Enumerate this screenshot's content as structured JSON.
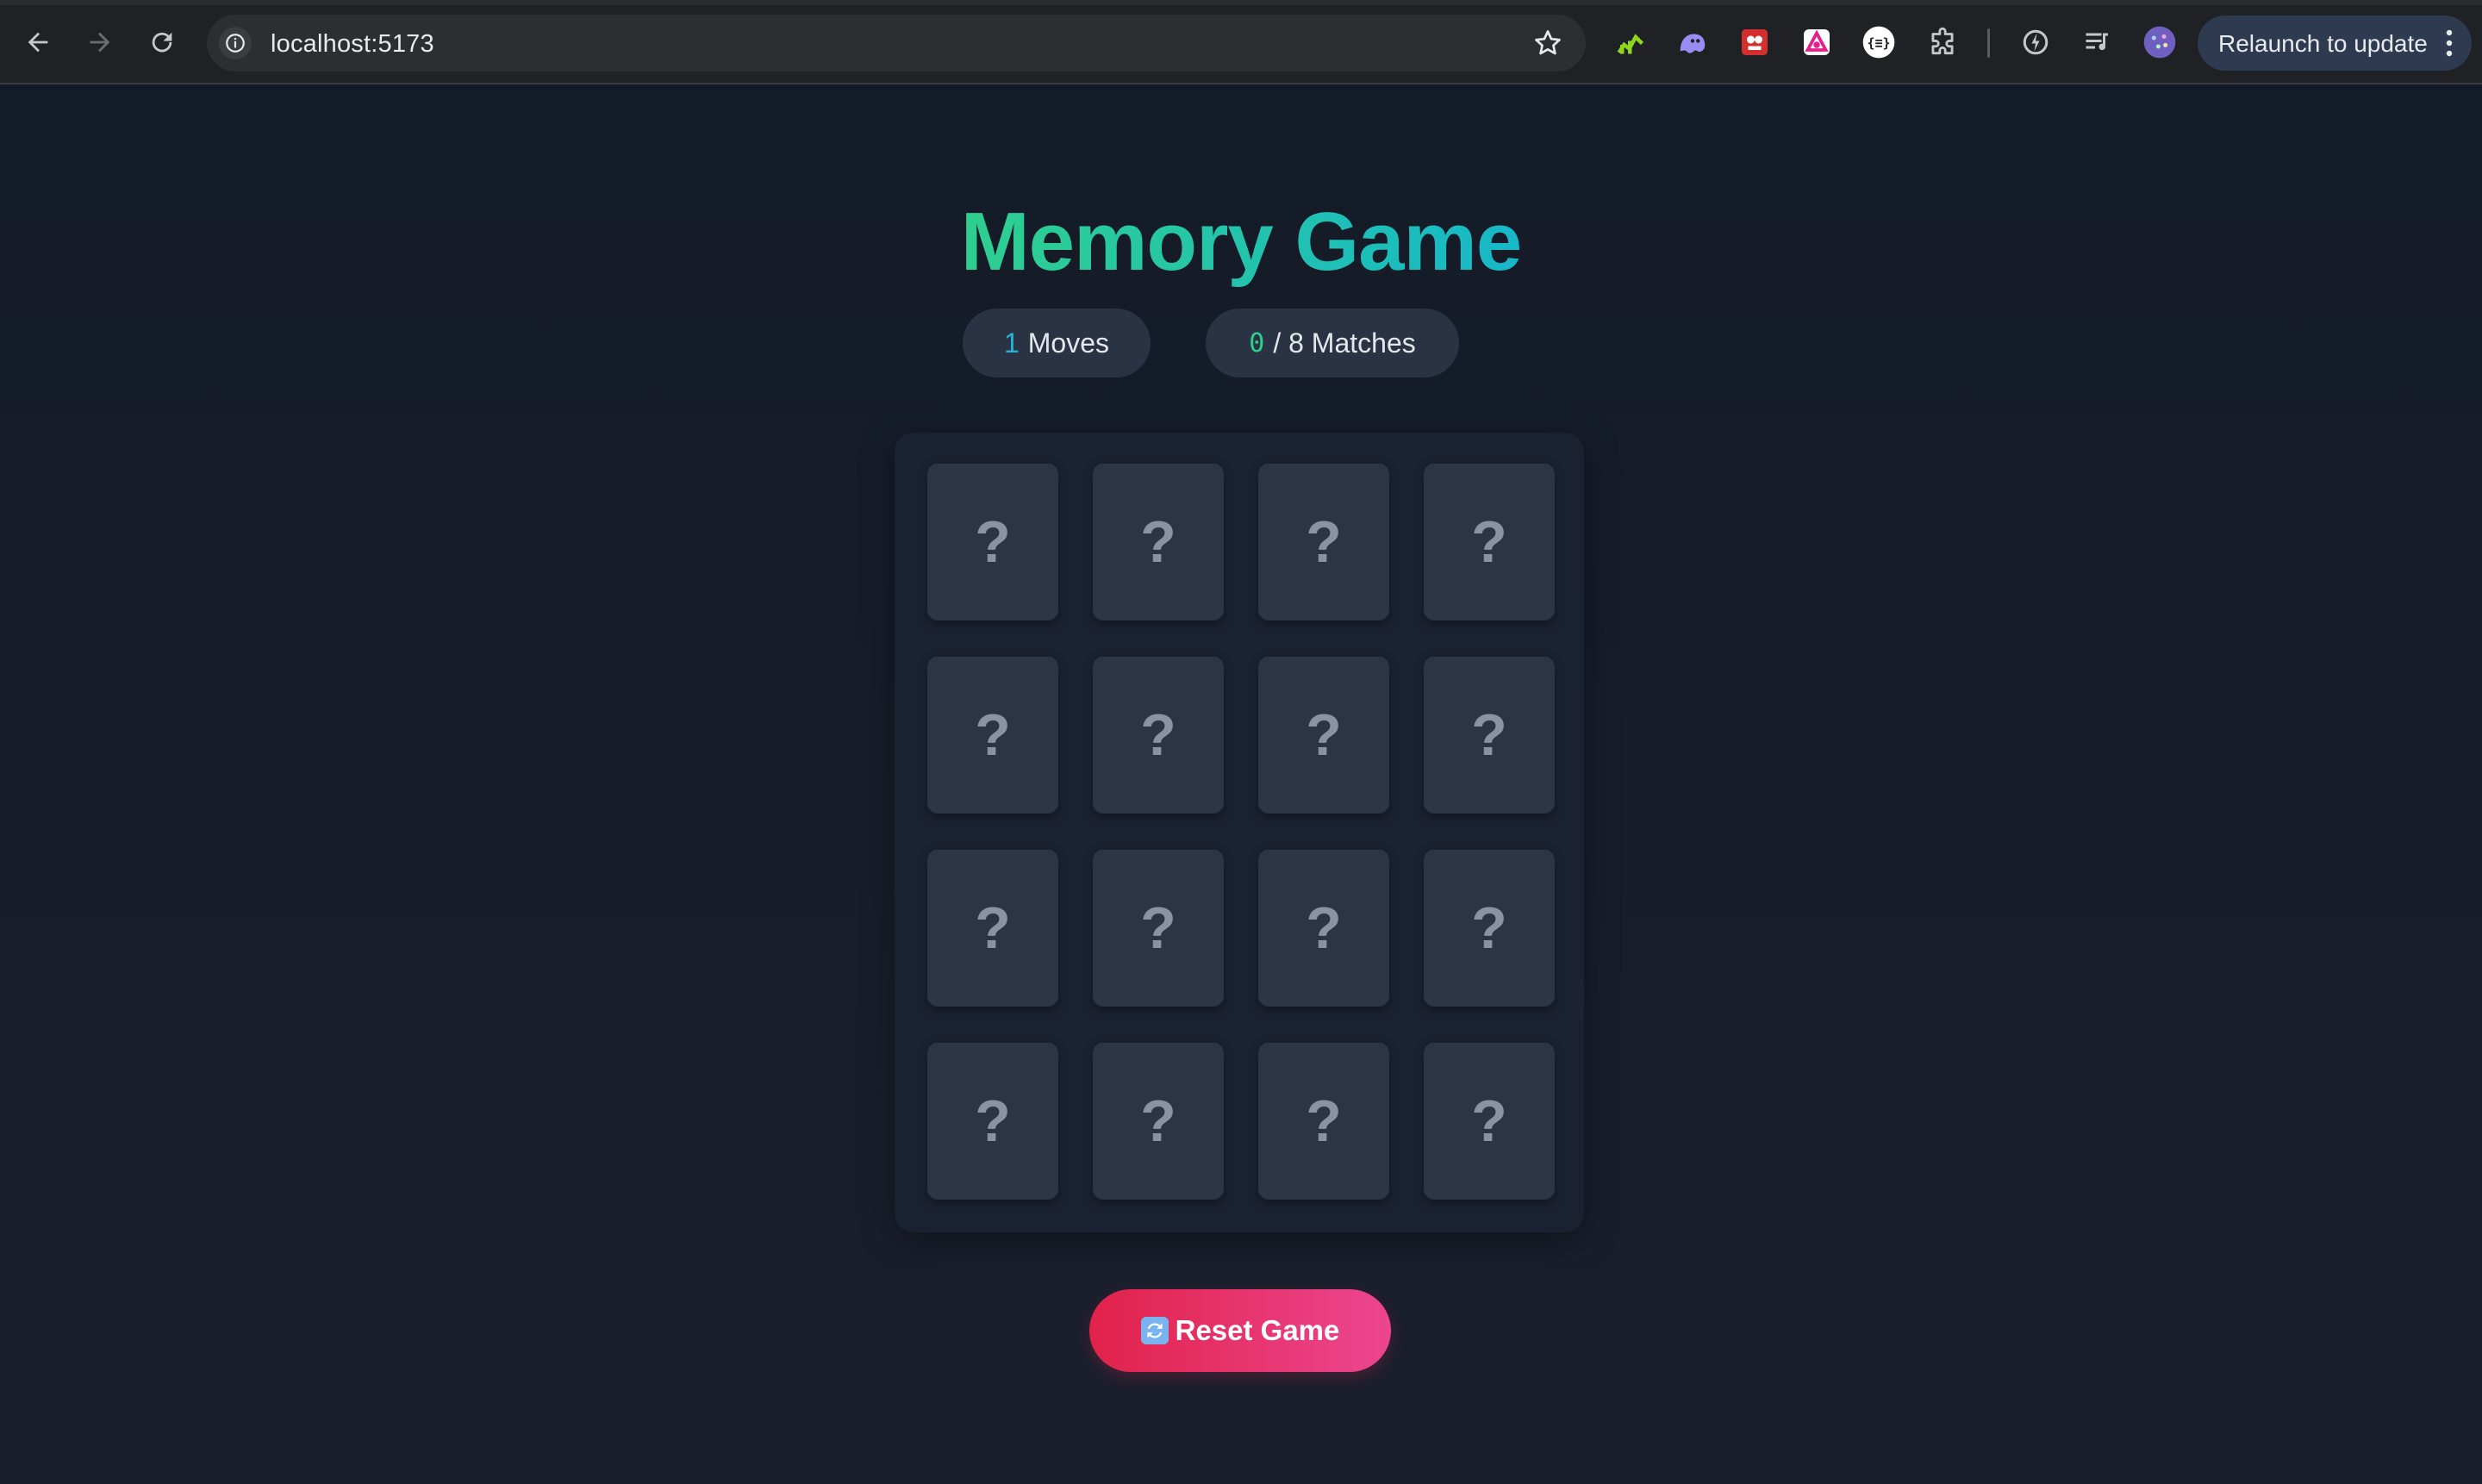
{
  "browser": {
    "url": "localhost:5173",
    "relaunch_label": "Relaunch to update",
    "toolbar_icons": [
      "back-icon",
      "forward-icon",
      "reload-icon",
      "site-info-icon",
      "bookmark-star-icon"
    ],
    "extension_icons": [
      "chart-extension-icon",
      "ghost-extension-icon",
      "red-extension-icon",
      "pink-extension-icon",
      "json-extension-icon",
      "puzzle-extensions-icon",
      "performance-icon",
      "media-controls-icon",
      "profile-avatar-icon"
    ]
  },
  "game": {
    "title": "Memory Game",
    "moves_count": "1",
    "moves_label": "Moves",
    "matches_count": "0",
    "matches_label": "/ 8 Matches",
    "cards": [
      "?",
      "?",
      "?",
      "?",
      "?",
      "?",
      "?",
      "?",
      "?",
      "?",
      "?",
      "?",
      "?",
      "?",
      "?",
      "?"
    ],
    "reset_label": "Reset Game",
    "reset_icon": "refresh-icon"
  },
  "colors": {
    "title_gradient_start": "#2fcf8f",
    "title_gradient_end": "#17b8c8",
    "moves_number": "#22b5d6",
    "matches_number": "#2ecf8a",
    "reset_gradient_start": "#e1224a",
    "reset_gradient_end": "#ec4690",
    "card_back": "#2c3545",
    "page_background": "#161d2b"
  }
}
